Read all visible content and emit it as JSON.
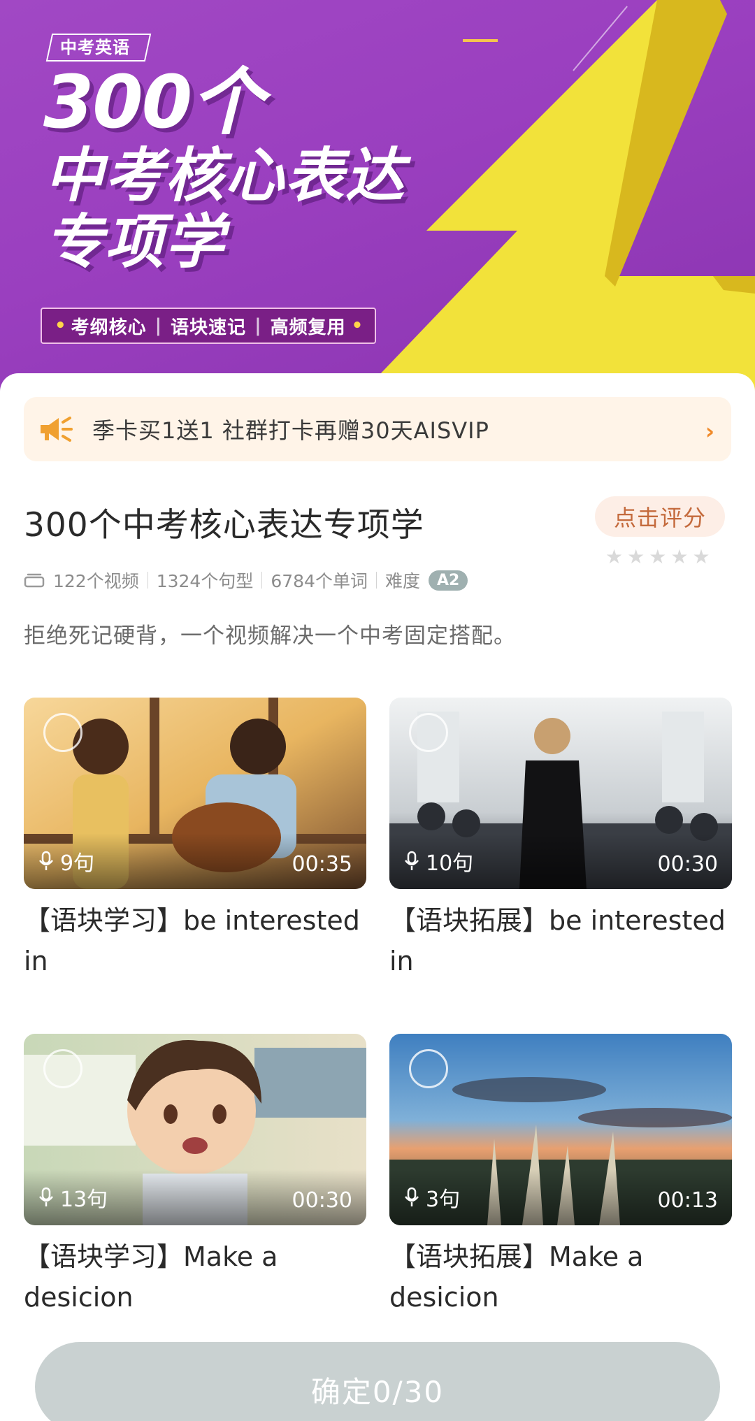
{
  "hero": {
    "tag": "中考英语",
    "big_number": "300个",
    "line2": "中考核心表达",
    "line3": "专项学",
    "features": [
      "考纲核心",
      "语块速记",
      "高频复用"
    ]
  },
  "promo": {
    "icon": "megaphone-icon",
    "text": "季卡买1送1  社群打卡再赠30天AISVIP",
    "chevron": "›"
  },
  "course": {
    "title": "300个中考核心表达专项学",
    "rate_label": "点击评分",
    "stars": 5,
    "videos": "122个视频",
    "sentences": "1324个句型",
    "words": "6784个单词",
    "difficulty_label": "难度",
    "difficulty": "A2",
    "description": "拒绝死记硬背，一个视频解决一个中考固定搭配。"
  },
  "videos": [
    {
      "count": "9句",
      "duration": "00:35",
      "title": "【语块学习】be interested in"
    },
    {
      "count": "10句",
      "duration": "00:30",
      "title": "【语块拓展】be interested in"
    },
    {
      "count": "13句",
      "duration": "00:30",
      "title": "【语块学习】Make a desicion"
    },
    {
      "count": "3句",
      "duration": "00:13",
      "title": "【语块拓展】Make a desicion"
    }
  ],
  "confirm": {
    "label": "确定0/30"
  },
  "colors": {
    "hero_purple": "#9a3fbf",
    "bolt_yellow": "#f2e23a",
    "promo_bg": "#fff4e8",
    "accent_orange": "#f08a2a",
    "confirm_bg": "#c9d1d1"
  }
}
